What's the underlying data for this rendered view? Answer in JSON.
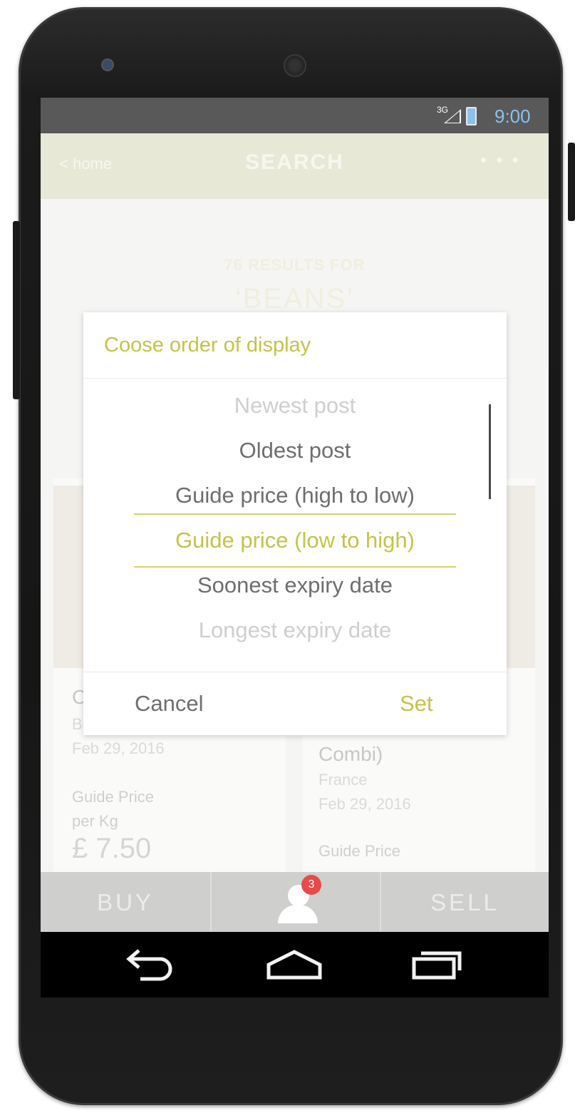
{
  "status_bar": {
    "network": "3G",
    "time": "9:00"
  },
  "app_bar": {
    "back_label": "< home",
    "title": "SEARCH",
    "menu": "• • •"
  },
  "search": {
    "results_count": "76 RESULTS FOR",
    "query": "‘BEANS’"
  },
  "cards": [
    {
      "title": "C",
      "subtitle": "B",
      "date": "Feb 29, 2016",
      "price_label_1": "Guide Price",
      "price_label_2": "per Kg",
      "price": "£ 7.50"
    },
    {
      "title": "Combi)",
      "origin": "France",
      "date": "Feb 29, 2016",
      "price_label_1": "Guide Price"
    }
  ],
  "dialog": {
    "title": "Coose order of display",
    "options": [
      "Newest post",
      "Oldest post",
      "Guide price (high to low)",
      "Guide price (low to high)",
      "Soonest expiry date",
      "Longest expiry date"
    ],
    "selected_index": 3,
    "cancel_label": "Cancel",
    "set_label": "Set",
    "accent_color": "#c5c34a"
  },
  "bottom_nav": {
    "buy_label": "BUY",
    "sell_label": "SELL",
    "notification_count": "3"
  },
  "colors": {
    "app_bar": "#dcdcc2",
    "badge": "#e84a4a",
    "status_time": "#4ba3e0"
  }
}
